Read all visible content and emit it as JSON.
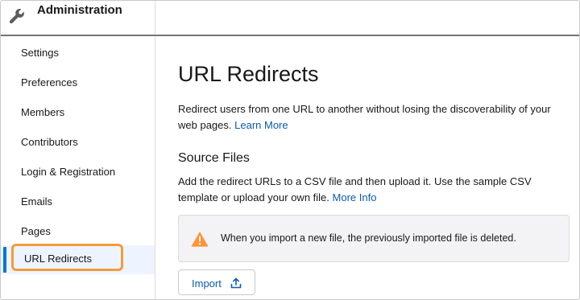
{
  "header": {
    "title": "Administration",
    "icon": "wrench-icon"
  },
  "sidebar": {
    "items": [
      {
        "label": "Settings",
        "active": false
      },
      {
        "label": "Preferences",
        "active": false
      },
      {
        "label": "Members",
        "active": false
      },
      {
        "label": "Contributors",
        "active": false
      },
      {
        "label": "Login & Registration",
        "active": false
      },
      {
        "label": "Emails",
        "active": false
      },
      {
        "label": "Pages",
        "active": false
      },
      {
        "label": "URL Redirects",
        "active": true
      }
    ]
  },
  "main": {
    "title": "URL Redirects",
    "description": "Redirect users from one URL to another without losing the discoverability of your web pages.",
    "learn_more_link": "Learn More",
    "section_title": "Source Files",
    "section_description": "Add the redirect URLs to a CSV file and then upload it. Use the sample CSV template or upload your own file.",
    "more_info_link": "More Info",
    "notice": {
      "icon": "warning-icon",
      "text": "When you import a new file, the previously imported file is deleted."
    },
    "import_button": {
      "label": "Import",
      "icon": "upload-icon"
    }
  },
  "colors": {
    "accent": "#0176d3",
    "link": "#0b5cab",
    "warning": "#fe9339",
    "highlight": "#f29c38",
    "active_bg": "#eef4ff"
  }
}
